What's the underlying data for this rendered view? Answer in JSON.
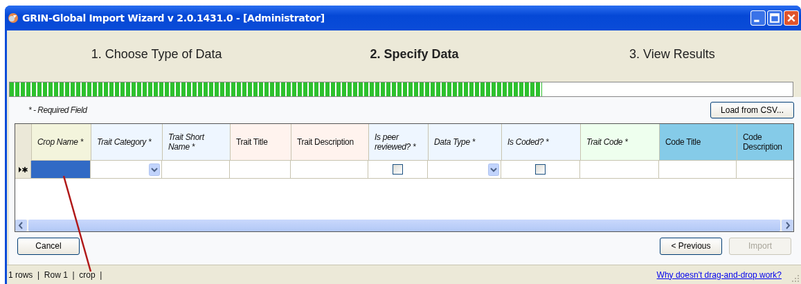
{
  "window": {
    "title": "GRIN-Global Import Wizard v 2.0.1431.0 - [Administrator]"
  },
  "steps": [
    {
      "label": "1.  Choose Type of Data",
      "selected": false
    },
    {
      "label": "2. Specify Data",
      "selected": true
    },
    {
      "label": "3.  View Results",
      "selected": false
    }
  ],
  "progress": {
    "level": 0.68
  },
  "required_note": "* - Required Field",
  "load_button": "Load from CSV...",
  "table": {
    "columns": [
      {
        "label": "Crop Name *",
        "required": true,
        "color": "#f3f4dc",
        "kind": "text"
      },
      {
        "label": "Trait Category *",
        "required": true,
        "color": "#eef6ff",
        "kind": "dropdown"
      },
      {
        "label": "Trait Short Name *",
        "required": true,
        "color": "#eef6ff",
        "kind": "text"
      },
      {
        "label": "Trait Title",
        "required": false,
        "color": "#fff3ee",
        "kind": "text"
      },
      {
        "label": "Trait Description",
        "required": false,
        "color": "#fff3ee",
        "kind": "text"
      },
      {
        "label": "Is peer reviewed? *",
        "required": true,
        "color": "#eef6ff",
        "kind": "checkbox"
      },
      {
        "label": "Data Type *",
        "required": true,
        "color": "#eef6ff",
        "kind": "dropdown"
      },
      {
        "label": "Is Coded? *",
        "required": true,
        "color": "#eef6ff",
        "kind": "checkbox"
      },
      {
        "label": "Trait Code *",
        "required": true,
        "color": "#eeffee",
        "kind": "text"
      },
      {
        "label": "Code Title",
        "required": false,
        "color": "#85cbe8",
        "kind": "text"
      },
      {
        "label": "Code Description",
        "required": false,
        "color": "#85cbe8",
        "kind": "text"
      }
    ],
    "new_row": [
      {
        "selected": true
      },
      {
        "selected": false
      },
      {
        "selected": false
      },
      {
        "selected": false
      },
      {
        "selected": false
      },
      {
        "selected": false,
        "checked": false
      },
      {
        "selected": false
      },
      {
        "selected": false,
        "checked": false
      },
      {
        "selected": false
      },
      {
        "selected": false
      },
      {
        "selected": false
      }
    ]
  },
  "buttons": [
    {
      "label": "Cancel",
      "disabled": false
    },
    {
      "label": "< Previous",
      "disabled": false
    },
    {
      "label": "Import",
      "disabled": true
    }
  ],
  "status_bar": {
    "text": "1 rows  |  Row 1  |  crop  |",
    "link": "Why doesn't drag-and-drop work?"
  }
}
